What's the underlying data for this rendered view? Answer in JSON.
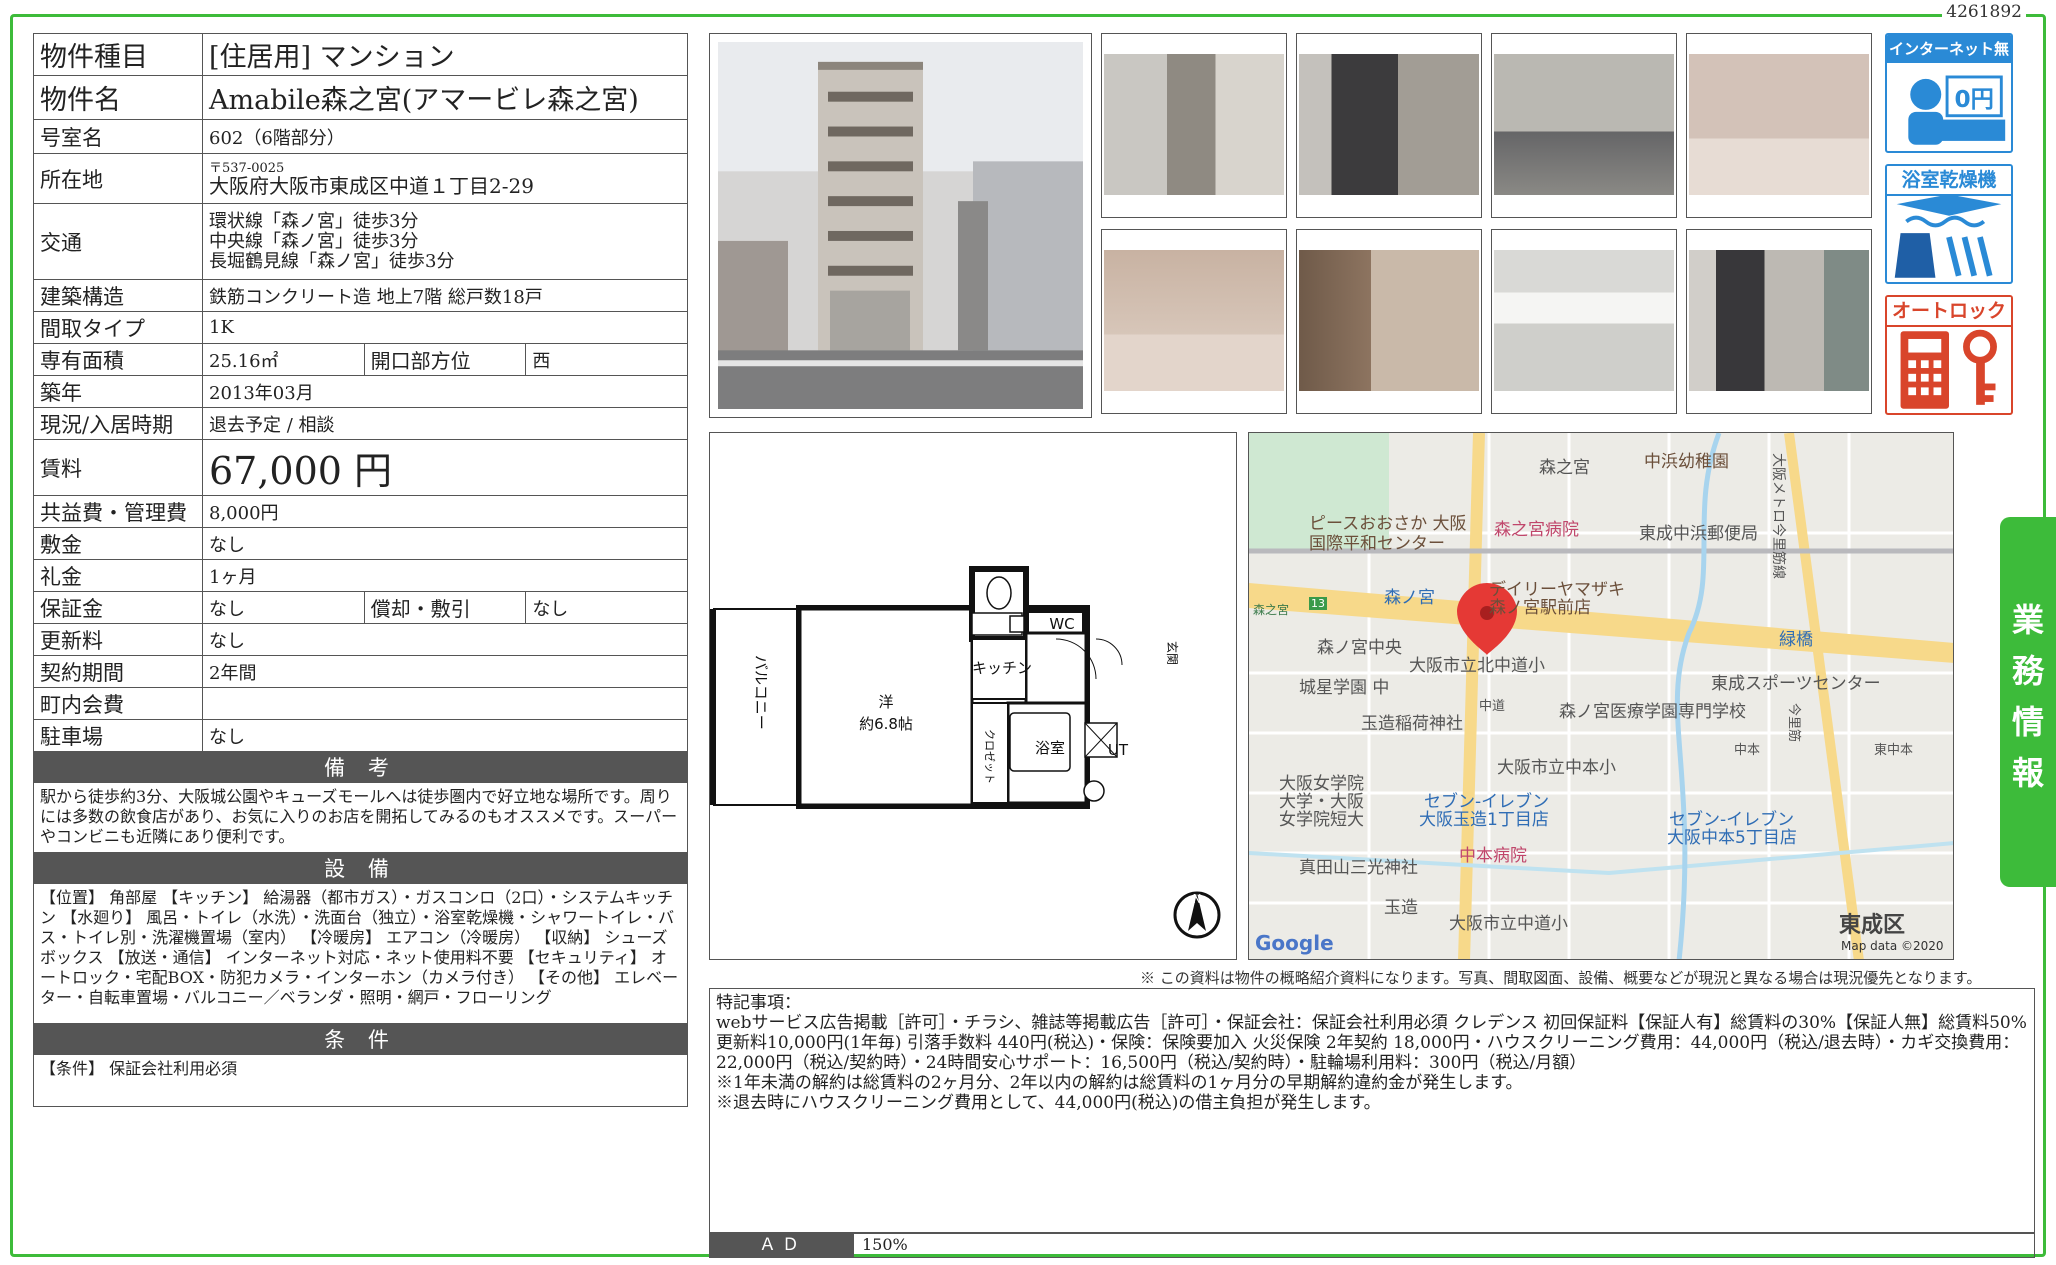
{
  "property_id": "4261892",
  "table": {
    "type_label": "物件種目",
    "type_value": "[住居用]  マンション",
    "name_label": "物件名",
    "name_value": "Amabile森之宮(アマービレ森之宮)",
    "room_label": "号室名",
    "room_value": "602（6階部分）",
    "addr_label": "所在地",
    "addr_zip": "〒537-0025",
    "addr_value": "大阪府大阪市東成区中道１丁目2-29",
    "access_label": "交通",
    "access_lines": [
      "環状線「森ノ宮」徒歩3分",
      "中央線「森ノ宮」徒歩3分",
      "長堀鶴見線「森ノ宮」徒歩3分"
    ],
    "structure_label": "建築構造",
    "structure_value": "鉄筋コンクリート造  地上7階  総戸数18戸",
    "layout_label": "間取タイプ",
    "layout_value": "1K",
    "area_label": "専有面積",
    "area_value": "25.16㎡",
    "dir_label": "開口部方位",
    "dir_value": "西",
    "built_label": "築年",
    "built_value": "2013年03月",
    "status_label": "現況/入居時期",
    "status_value": "退去予定 / 相談",
    "rent_label": "賃料",
    "rent_value": "67,000 円",
    "fee_label": "共益費・管理費",
    "fee_value": "8,000円",
    "deposit_label": "敷金",
    "deposit_value": "なし",
    "key_label": "礼金",
    "key_value": "1ヶ月",
    "guarantee_label": "保証金",
    "guarantee_value": "なし",
    "amort_label": "償却・敷引",
    "amort_value": "なし",
    "renew_label": "更新料",
    "renew_value": "なし",
    "term_label": "契約期間",
    "term_value": "2年間",
    "town_label": "町内会費",
    "town_value": "",
    "parking_label": "駐車場",
    "parking_value": "なし",
    "remarks_header": "備 考",
    "remarks_text": "駅から徒歩約3分、大阪城公園やキューズモールへは徒歩圏内で好立地な場所です。周りには多数の飲食店があり、お気に入りのお店を開拓してみるのもオススメです。スーパーやコンビニも近隣にあり便利です。",
    "equipment_header": "設 備",
    "equipment_text": "【位置】 角部屋 【キッチン】 給湯器（都市ガス）・ガスコンロ（2口）・システムキッチン 【水廻り】 風呂・トイレ（水洗）・洗面台（独立）・浴室乾燥機・シャワートイレ・バス・トイレ別・洗濯機置場（室内） 【冷暖房】 エアコン（冷暖房） 【収納】 シューズボックス 【放送・通信】 インターネット対応・ネット使用料不要 【セキュリティ】 オートロック・宅配BOX・防犯カメラ・インターホン（カメラ付き） 【その他】 エレベーター・自転車置場・バルコニー／ベランダ・照明・網戸・フローリング",
    "conditions_header": "条 件",
    "conditions_text": "【条件】 保証会社利用必須"
  },
  "badges": [
    {
      "title": "インターネット無料",
      "icon": "internet-free-icon",
      "sub": "0円"
    },
    {
      "title": "浴室乾燥機",
      "icon": "bathroom-dryer-icon"
    },
    {
      "title": "オートロック",
      "icon": "autolock-icon"
    }
  ],
  "floorplan": {
    "balcony": "バルコニー",
    "room": "洋",
    "room_size": "約6.8帖",
    "kitchen": "キッチン",
    "wc": "WC",
    "entrance": "玄関",
    "bath": "浴室",
    "ut": "UT",
    "closet": "クロゼット"
  },
  "map": {
    "labels": [
      "森之宮",
      "中浜幼稚園",
      "ピースおおさか 大阪",
      "国際平和センター",
      "森之宮病院",
      "東成中浜郵便局",
      "森ノ宮",
      "デイリーヤマザキ",
      "森ノ宮駅前店",
      "森之宮",
      "森ノ宮中央",
      "大阪市立北中道小",
      "緑橋",
      "城星学園 中",
      "東成スポーツセンター",
      "玉造稲荷神社",
      "中道",
      "森ノ宮医療学園専門学校",
      "大阪市立中本小",
      "中本",
      "東中本",
      "大阪女学院",
      "大学・大阪",
      "女学院短大",
      "セブン-イレブン",
      "大阪玉造1丁目店",
      "セブン-イレブン",
      "大阪中本5丁目店",
      "中本病院",
      "真田山三光神社",
      "玉造",
      "大阪市立中道小",
      "東成区",
      "大阪メトロ今里筋線",
      "今里筋",
      "13"
    ],
    "google": "Google",
    "mapdata": "Map data ©2020"
  },
  "disclaimer": "※ この資料は物件の概略紹介資料になります。写真、間取図面、設備、概要などが現況と異なる場合は現況優先となります。",
  "notes": {
    "heading": "特記事項：",
    "lines": [
      "webサービス広告掲載［許可］・チラシ、雑誌等掲載広告［許可］・保証会社：保証会社利用必須 クレデンス 初回保証料【保証人有】総賃料の30%【保証人無】総賃料50% 更新料10,000円(1年毎) 引落手数料 440円(税込)・保険：保険要加入 火災保険 2年契約 18,000円・ハウスクリーニング費用：44,000円（税込/退去時）・カギ交換費用：22,000円（税込/契約時）・24時間安心サポート：16,500円（税込/契約時）・駐輪場利用料：300円（税込/月額）",
      "※1年未満の解約は総賃料の2ヶ月分、2年以内の解約は総賃料の1ヶ月分の早期解約違約金が発生します。",
      "※退去時にハウスクリーニング費用として、44,000円(税込)の借主負担が発生します。"
    ]
  },
  "ad": {
    "label": "ＡＤ",
    "value": "150%"
  },
  "side_tab": "業務情報"
}
